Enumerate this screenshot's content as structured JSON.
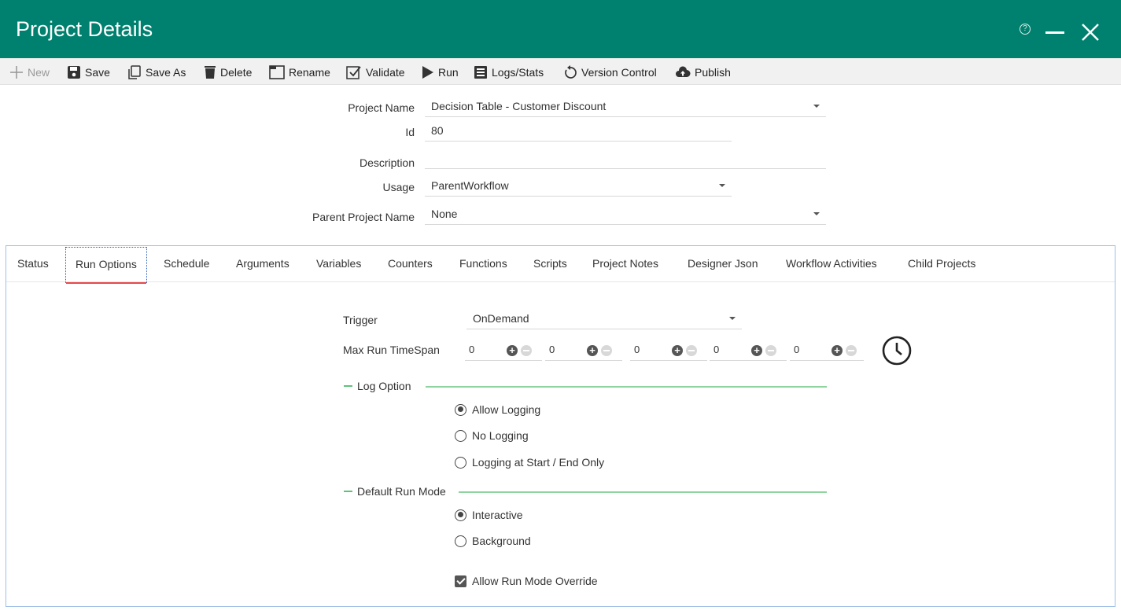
{
  "window": {
    "title": "Project Details",
    "help_glyph": "?"
  },
  "toolbar": {
    "new": "New",
    "save": "Save",
    "save_as": "Save As",
    "delete": "Delete",
    "rename": "Rename",
    "validate": "Validate",
    "run": "Run",
    "logs_stats": "Logs/Stats",
    "version_control": "Version Control",
    "publish": "Publish"
  },
  "form": {
    "project_name_label": "Project Name",
    "project_name_value": "Decision Table - Customer Discount",
    "id_label": "Id",
    "id_value": "80",
    "description_label": "Description",
    "description_value": "",
    "usage_label": "Usage",
    "usage_value": "ParentWorkflow",
    "parent_label": "Parent Project Name",
    "parent_value": "None"
  },
  "tabs": [
    "Status",
    "Run Options",
    "Schedule",
    "Arguments",
    "Variables",
    "Counters",
    "Functions",
    "Scripts",
    "Project Notes",
    "Designer Json",
    "Workflow Activities",
    "Child Projects"
  ],
  "active_tab": "Run Options",
  "run_options": {
    "trigger_label": "Trigger",
    "trigger_value": "OnDemand",
    "max_run_label": "Max Run TimeSpan",
    "timespan": [
      "0",
      "0",
      "0",
      "0",
      "0"
    ],
    "log_option_label": "Log Option",
    "log_options": [
      "Allow Logging",
      "No Logging",
      "Logging at Start / End Only"
    ],
    "log_selected": "Allow Logging",
    "run_mode_label": "Default Run Mode",
    "run_modes": [
      "Interactive",
      "Background"
    ],
    "run_mode_selected": "Interactive",
    "override_label": "Allow Run Mode Override",
    "override_checked": true
  },
  "colors": {
    "header": "#00806e",
    "accent_green": "#5ec27a",
    "tab_underline": "#e8474a"
  },
  "icons": [
    "help-icon",
    "minimize-icon",
    "close-icon",
    "plus-icon",
    "save-icon",
    "copy-icon",
    "trash-icon",
    "rename-icon",
    "validate-icon",
    "play-icon",
    "list-icon",
    "undo-icon",
    "cloud-upload-icon",
    "clock-icon",
    "chevron-down-icon"
  ]
}
